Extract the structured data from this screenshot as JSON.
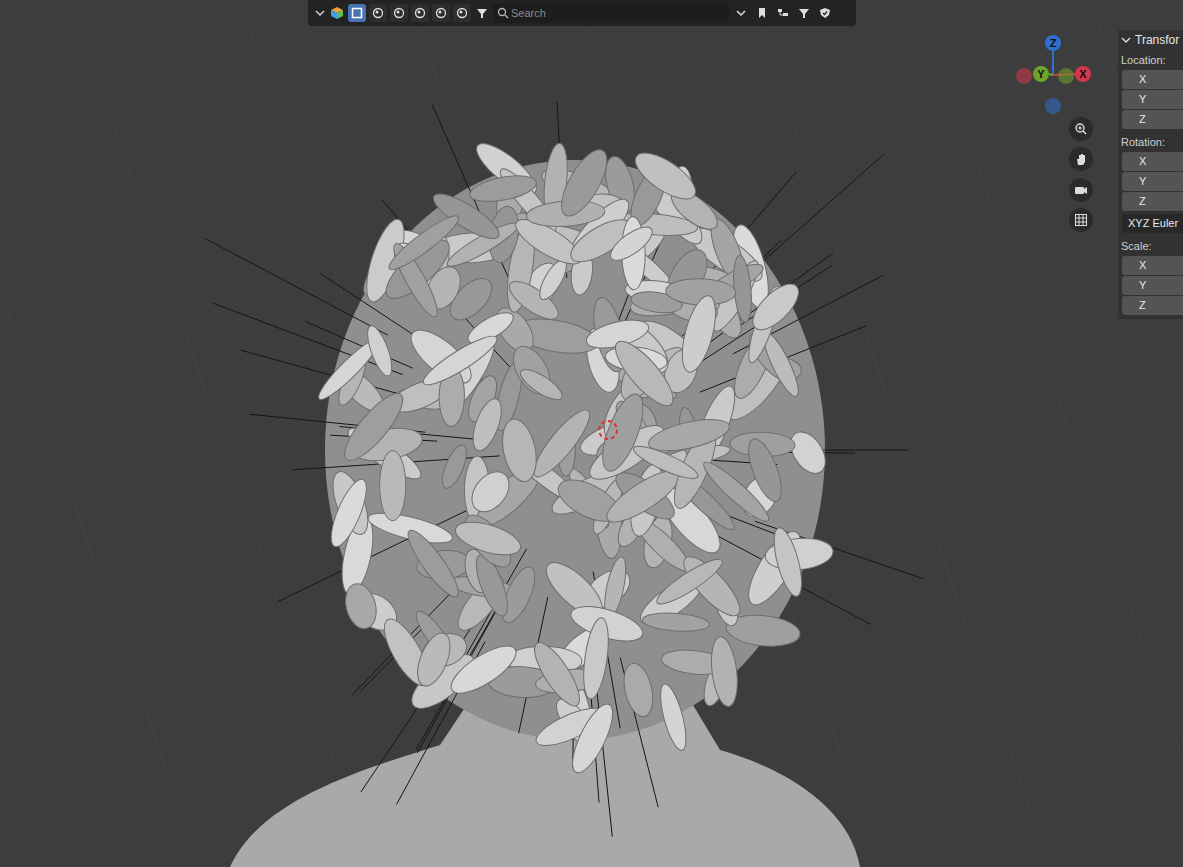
{
  "header": {
    "modes": [
      {
        "selected": true
      },
      {
        "selected": false
      },
      {
        "selected": false
      },
      {
        "selected": false
      },
      {
        "selected": false
      },
      {
        "selected": false
      }
    ],
    "search": {
      "placeholder": "Search"
    }
  },
  "gizmo": {
    "axes": [
      {
        "label": "Z",
        "color": "#2f6fd0"
      },
      {
        "label": "Y",
        "color": "#6da22b"
      },
      {
        "label": "X",
        "color": "#d3364d"
      }
    ]
  },
  "panel": {
    "title": "Transfor",
    "expanded": true,
    "sections": [
      {
        "label": "Location:",
        "fields": [
          "X",
          "Y",
          "Z"
        ]
      },
      {
        "label": "Rotation:",
        "fields": [
          "X",
          "Y",
          "Z"
        ],
        "mode": "XYZ Euler"
      },
      {
        "label": "Scale:",
        "fields": [
          "X",
          "Y",
          "Z"
        ]
      }
    ]
  }
}
